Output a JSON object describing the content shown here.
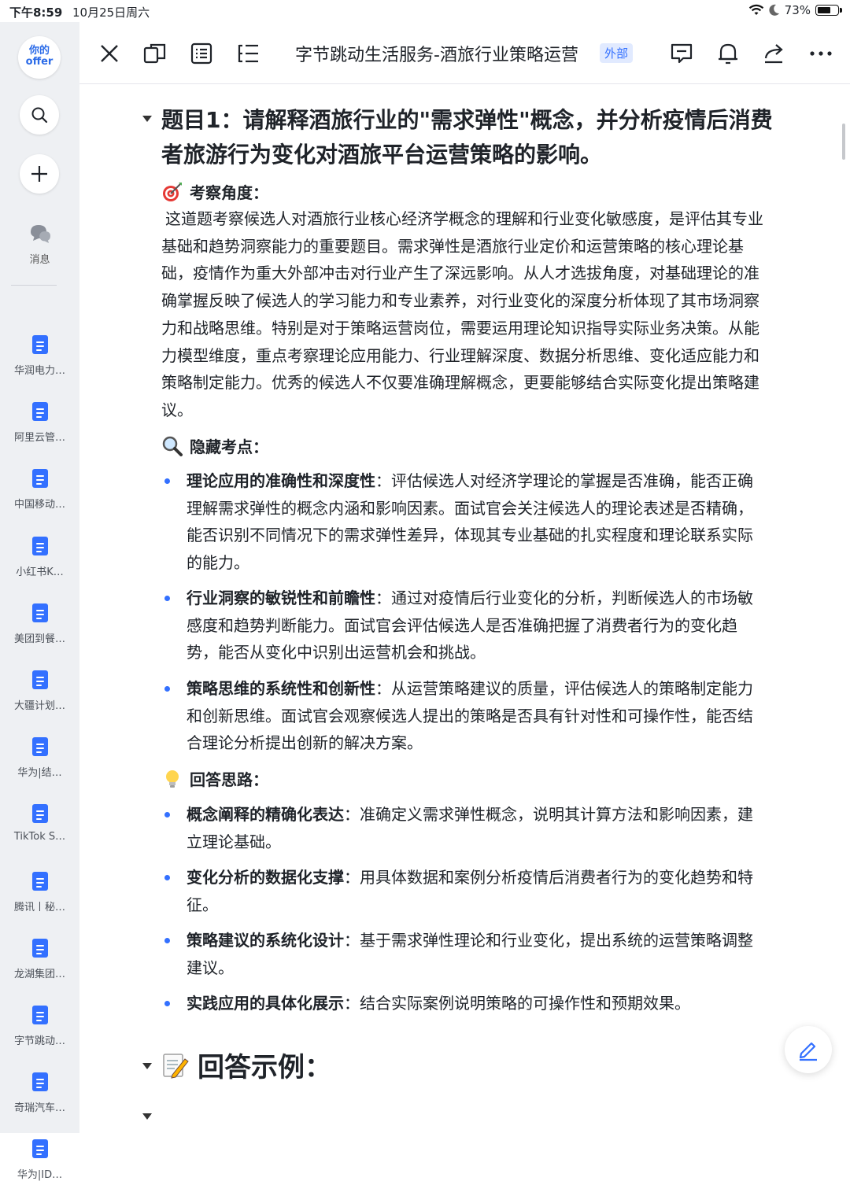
{
  "status_bar": {
    "time": "下午8:59",
    "date": "10月25日周六",
    "battery": "73%",
    "battery_level": 0.73
  },
  "sidebar": {
    "logo_line1": "你的",
    "logo_line2": "offer",
    "messages_label": "消息",
    "items": [
      {
        "label": "华润电力…"
      },
      {
        "label": "阿里云管…"
      },
      {
        "label": "中国移动…"
      },
      {
        "label": "小红书K…"
      },
      {
        "label": "美团到餐…"
      },
      {
        "label": "大疆计划…"
      },
      {
        "label": "华为|结…"
      },
      {
        "label": "TikTok S…"
      },
      {
        "label": "腾讯丨秘…"
      },
      {
        "label": "龙湖集团…"
      },
      {
        "label": "字节跳动…"
      },
      {
        "label": "奇瑞汽车…"
      },
      {
        "label": "华为|ID…"
      }
    ]
  },
  "toolbar": {
    "title": "字节跳动生活服务-酒旅行业策略运营",
    "badge": "外部"
  },
  "doc": {
    "heading": "题目1：请解释酒旅行业的\"需求弹性\"概念，并分析疫情后消费者旅游行为变化对酒旅平台运营策略的影响。",
    "perspective_title": "考察角度：",
    "perspective_text": "这道题考察候选人对酒旅行业核心经济学概念的理解和行业变化敏感度，是评估其专业基础和趋势洞察能力的重要题目。需求弹性是酒旅行业定价和运营策略的核心理论基础，疫情作为重大外部冲击对行业产生了深远影响。从人才选拔角度，对基础理论的准确掌握反映了候选人的学习能力和专业素养，对行业变化的深度分析体现了其市场洞察力和战略思维。特别是对于策略运营岗位，需要运用理论知识指导实际业务决策。从能力模型维度，重点考察理论应用能力、行业理解深度、数据分析思维、变化适应能力和策略制定能力。优秀的候选人不仅要准确理解概念，更要能够结合实际变化提出策略建议。",
    "hidden_title": "隐藏考点：",
    "hidden_points": [
      {
        "bold": "理论应用的准确性和深度性",
        "text": "：评估候选人对经济学理论的掌握是否准确，能否正确理解需求弹性的概念内涵和影响因素。面试官会关注候选人的理论表述是否精确，能否识别不同情况下的需求弹性差异，体现其专业基础的扎实程度和理论联系实际的能力。"
      },
      {
        "bold": "行业洞察的敏锐性和前瞻性",
        "text": "：通过对疫情后行业变化的分析，判断候选人的市场敏感度和趋势判断能力。面试官会评估候选人是否准确把握了消费者行为的变化趋势，能否从变化中识别出运营机会和挑战。"
      },
      {
        "bold": "策略思维的系统性和创新性",
        "text": "：从运营策略建议的质量，评估候选人的策略制定能力和创新思维。面试官会观察候选人提出的策略是否具有针对性和可操作性，能否结合理论分析提出创新的解决方案。"
      }
    ],
    "approach_title": "回答思路：",
    "approach_points": [
      {
        "bold": "概念阐释的精确化表达",
        "text": "：准确定义需求弹性概念，说明其计算方法和影响因素，建立理论基础。"
      },
      {
        "bold": "变化分析的数据化支撑",
        "text": "：用具体数据和案例分析疫情后消费者行为的变化趋势和特征。"
      },
      {
        "bold": "策略建议的系统化设计",
        "text": "：基于需求弹性理论和行业变化，提出系统的运营策略调整建议。"
      },
      {
        "bold": "实践应用的具体化展示",
        "text": "：结合实际案例说明策略的可操作性和预期效果。"
      }
    ],
    "example_title": "回答示例："
  },
  "colors": {
    "accent": "#3370ff",
    "sidebar_bg": "#eef0f3"
  }
}
